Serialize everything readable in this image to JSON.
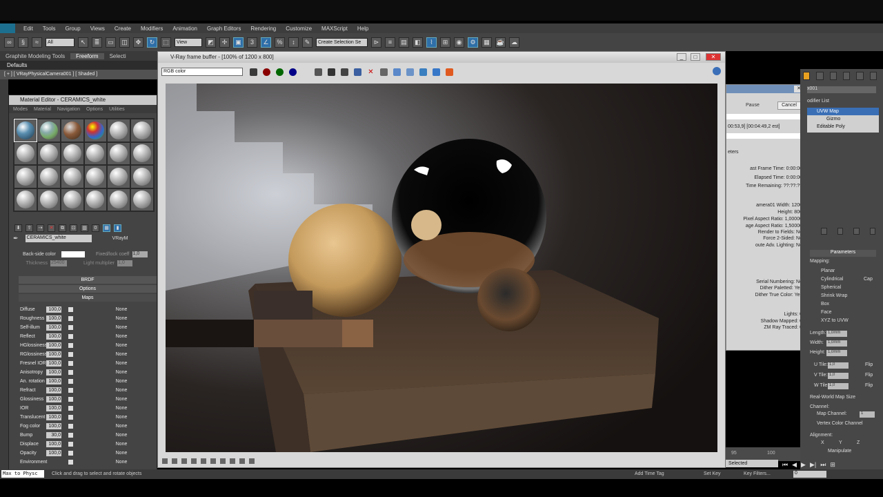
{
  "menubar": {
    "items": [
      "Edit",
      "Tools",
      "Group",
      "Views",
      "Create",
      "Modifiers",
      "Animation",
      "Graph Editors",
      "Rendering",
      "Customize",
      "MAXScript",
      "Help"
    ]
  },
  "toolbar": {
    "select_filter": "All",
    "ref_coord": "View",
    "named_selection": "Create Selection Se"
  },
  "ribbon": {
    "tabs": [
      "Graphite Modeling Tools",
      "Freeform",
      "Selecti"
    ],
    "defaults": "Defaults"
  },
  "viewport_label": "[ + ] [ VRayPhysicalCamera001 ] [ Shaded ]",
  "material_editor": {
    "title": "Material Editor - CERAMICS_white",
    "menu": [
      "Modes",
      "Material",
      "Navigation",
      "Options",
      "Utilities"
    ],
    "material_name": "CERAMICS_white",
    "material_type": "VRayM",
    "backside_label": "Back-side color",
    "fixed_label": "Fixed/lock coeff",
    "fixed_value": "1,0",
    "thickness_label": "Thickness",
    "thickness_value": "25400",
    "light_mult_label": "Light multiplier",
    "light_mult_value": "1,0",
    "rollouts": [
      "BRDF",
      "Options",
      "Maps"
    ],
    "maps": [
      {
        "name": "Diffuse",
        "value": "100,0",
        "map": "None"
      },
      {
        "name": "Roughness",
        "value": "100,0",
        "map": "None"
      },
      {
        "name": "Self-illum",
        "value": "100,0",
        "map": "None"
      },
      {
        "name": "Reflect",
        "value": "100,0",
        "map": "None"
      },
      {
        "name": "HGlossiness",
        "value": "100,0",
        "map": "None"
      },
      {
        "name": "RGlossiness",
        "value": "100,0",
        "map": "None"
      },
      {
        "name": "Fresnel IOR",
        "value": "100,0",
        "map": "None"
      },
      {
        "name": "Anisotropy",
        "value": "100,0",
        "map": "None"
      },
      {
        "name": "An. rotation",
        "value": "100,0",
        "map": "None"
      },
      {
        "name": "Refract",
        "value": "100,0",
        "map": "None"
      },
      {
        "name": "Glossiness",
        "value": "100,0",
        "map": "None"
      },
      {
        "name": "IOR",
        "value": "100,0",
        "map": "None"
      },
      {
        "name": "Translucent",
        "value": "100,0",
        "map": "None"
      },
      {
        "name": "Fog color",
        "value": "100,0",
        "map": "None"
      },
      {
        "name": "Bump",
        "value": "30,0",
        "map": "None"
      },
      {
        "name": "Displace",
        "value": "100,0",
        "map": "None"
      },
      {
        "name": "Opacity",
        "value": "100,0",
        "map": "None"
      },
      {
        "name": "Environment",
        "value": "",
        "map": "None"
      }
    ]
  },
  "vfb": {
    "title": "V-Ray frame buffer - [100% of 1200 x 800]",
    "channel": "RGB color"
  },
  "progress": {
    "pause": "Pause",
    "cancel": "Cancel",
    "time_line": "00:53,9] [00:04:49,2 est]",
    "section": "eters",
    "lines": [
      "ast Frame Time: 0:00:00",
      "Elapsed Time: 0:00:00",
      "Time Remaining: ??:??:??",
      "amera01   Width: 1200",
      "Height: 800",
      "Pixel Aspect Ratio: 1,00000",
      "age Aspect Ratio: 1,50000",
      "Render to Fields: No",
      "Force 2-Sided: No",
      "oute Adv. Lighting: No",
      "Serial Numbering: No",
      "Dither Paletted: Yes",
      "Dither True Color: Yes",
      "Lights: 0",
      "Shadow Mapped: 0",
      "ZM    Ray Traced: 0"
    ]
  },
  "modifier_panel": {
    "object_name": "x001",
    "list_label": "odifier List",
    "stack": [
      "UVW Map",
      "Gizmo",
      "Editable Poly"
    ],
    "params_title": "Parameters",
    "mapping_label": "Mapping:",
    "mappings": [
      "Planar",
      "Cylindrical",
      "Spherical",
      "Shrink Wrap",
      "Box",
      "Face",
      "XYZ to UVW"
    ],
    "cap_label": "Cap",
    "length_label": "Length:",
    "length": "1,0mm",
    "width_label": "Width:",
    "width": "1,0mm",
    "height_label": "Height:",
    "height": "1,0mm",
    "utile_label": "U Tile:",
    "vtile_label": "V Tile:",
    "wtile_label": "W Tile:",
    "tile": "1,0",
    "flip": "Flip",
    "realworld": "Real-World Map Size",
    "channel_label": "Channel:",
    "map_channel": "Map Channel:",
    "map_channel_value": "1",
    "vertex_color": "Vertex Color Channel",
    "alignment": "Alignment:",
    "axes": [
      "X",
      "Y",
      "Z"
    ],
    "manipulate": "Manipulate"
  },
  "statusbar": {
    "script": "Max to Physc",
    "hint": "Click and drag to select and rotate objects",
    "add_tag": "Add Time Tag",
    "set_key": "Set Key",
    "key_filters": "Key Filters...",
    "selected": "Selected",
    "frame_value": "0",
    "tick_95": "95",
    "tick_100": "100"
  },
  "colors": {
    "accent": "#2f6fa8",
    "panel": "#444444",
    "vfb_bg": "#d8d8d8"
  }
}
